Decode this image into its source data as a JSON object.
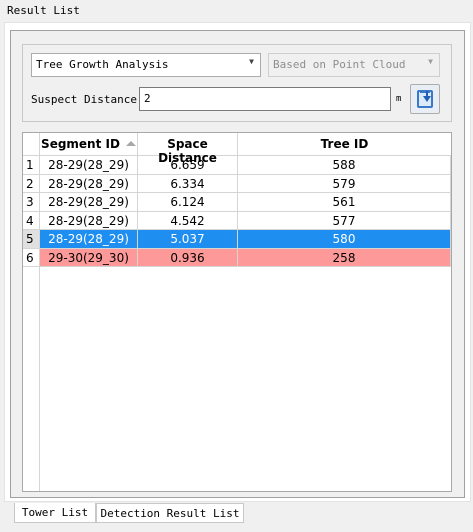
{
  "panel_title": "Result List",
  "analysis": {
    "type_select": "Tree Growth Analysis",
    "mode_select": "Based on Point Cloud",
    "distance_label": "Suspect Distance:",
    "distance_value": "2",
    "distance_unit": "m"
  },
  "table": {
    "columns": [
      "Segment ID",
      "Space Distance",
      "Tree ID"
    ],
    "sorted_column": "Segment ID",
    "rows": [
      {
        "num": "1",
        "segment_id": "28-29(28_29)",
        "space_distance": "6.659",
        "tree_id": "588",
        "state": "normal"
      },
      {
        "num": "2",
        "segment_id": "28-29(28_29)",
        "space_distance": "6.334",
        "tree_id": "579",
        "state": "normal"
      },
      {
        "num": "3",
        "segment_id": "28-29(28_29)",
        "space_distance": "6.124",
        "tree_id": "561",
        "state": "normal"
      },
      {
        "num": "4",
        "segment_id": "28-29(28_29)",
        "space_distance": "4.542",
        "tree_id": "577",
        "state": "normal"
      },
      {
        "num": "5",
        "segment_id": "28-29(28_29)",
        "space_distance": "5.037",
        "tree_id": "580",
        "state": "selected"
      },
      {
        "num": "6",
        "segment_id": "29-30(29_30)",
        "space_distance": "0.936",
        "tree_id": "258",
        "state": "alert"
      }
    ]
  },
  "tabs": [
    {
      "label": "Tower List",
      "active": true
    },
    {
      "label": "Detection Result List",
      "active": false
    }
  ],
  "colors": {
    "selected_row": "#1e8ef0",
    "alert_row": "#fe9999"
  },
  "icons": {
    "export": "export-down-icon",
    "dropdown": "chevron-down-icon",
    "sort": "sort-up-icon"
  }
}
